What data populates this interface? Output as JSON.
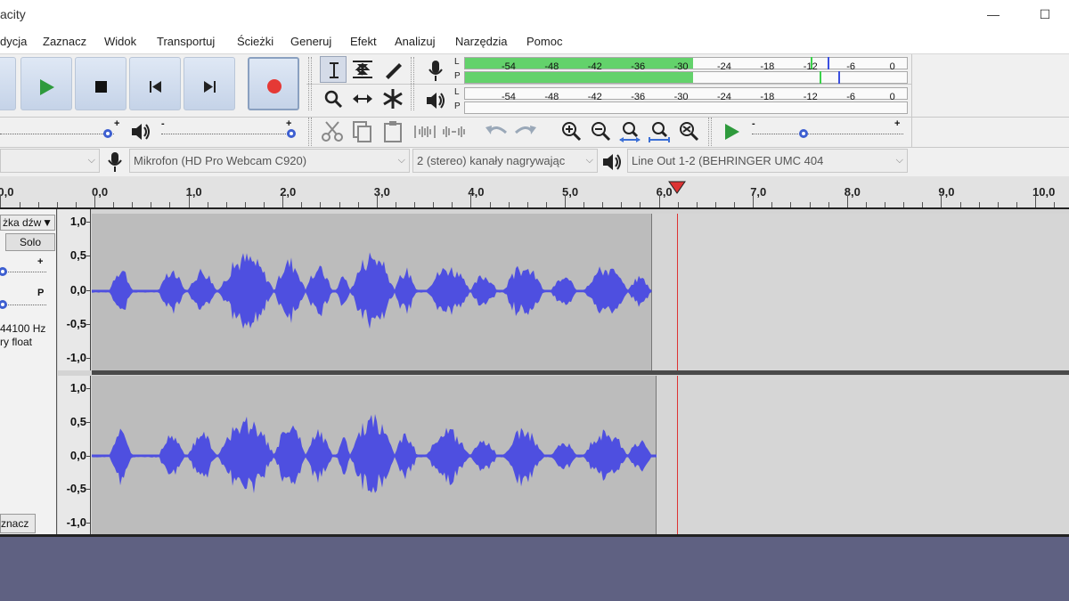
{
  "window": {
    "title": "acity",
    "minimize": "—",
    "maximize": "☐"
  },
  "menu": [
    "dycja",
    "Zaznacz",
    "Widok",
    "Transportuj",
    "Ścieżki",
    "Generuj",
    "Efekt",
    "Analizuj",
    "Narzędzia",
    "Pomoc"
  ],
  "meters": {
    "record_letters": [
      "L",
      "P"
    ],
    "play_letters": [
      "L",
      "P"
    ],
    "ticks": [
      "-54",
      "-48",
      "-42",
      "-36",
      "-30",
      "-24",
      "-18",
      "-12",
      "-6",
      "0"
    ],
    "record_level_db": -30,
    "fill_color": "#63d26b"
  },
  "sliders": {
    "minus": "-",
    "plus": "+",
    "record_volume": 1.0,
    "play_volume": 1.0,
    "play_speed": 0.35
  },
  "devices": {
    "host": "",
    "mic": "Mikrofon (HD Pro Webcam C920)",
    "channels": "2 (stereo) kanały nagrywając",
    "output": "Line Out 1-2 (BEHRINGER UMC 404"
  },
  "timeline": {
    "labels": [
      "0,0",
      "0,0",
      "1,0",
      "2,0",
      "3,0",
      "4,0",
      "5,0",
      "6,0",
      "7,0",
      "8,0",
      "9,0",
      "10,0"
    ]
  },
  "track": {
    "name": "żka dźw",
    "dropdown": "▼",
    "solo": "Solo",
    "pan_letter": "P",
    "rate": "44100 Hz",
    "format": "ry float",
    "select": "znacz",
    "vruler": [
      "1,0",
      "0,5",
      "0,0",
      "-0,5",
      "-1,0"
    ]
  },
  "colors": {
    "waveform": "#4e4fe0",
    "clip": "#bcbcbc",
    "playhead": "#d33333",
    "record": "#e53935",
    "play": "#2e9a3c"
  },
  "icons": [
    "play-icon",
    "stop-icon",
    "skip-start-icon",
    "skip-end-icon",
    "record-icon",
    "selection-tool-icon",
    "envelope-tool-icon",
    "draw-tool-icon",
    "zoom-tool-icon",
    "time-shift-tool-icon",
    "multi-tool-icon",
    "microphone-icon",
    "speaker-icon",
    "cut-icon",
    "copy-icon",
    "paste-icon",
    "trim-icon",
    "silence-icon",
    "undo-icon",
    "redo-icon",
    "zoom-in-icon",
    "zoom-out-icon",
    "fit-selection-icon",
    "fit-project-icon",
    "zoom-toggle-icon",
    "play-at-speed-icon"
  ]
}
